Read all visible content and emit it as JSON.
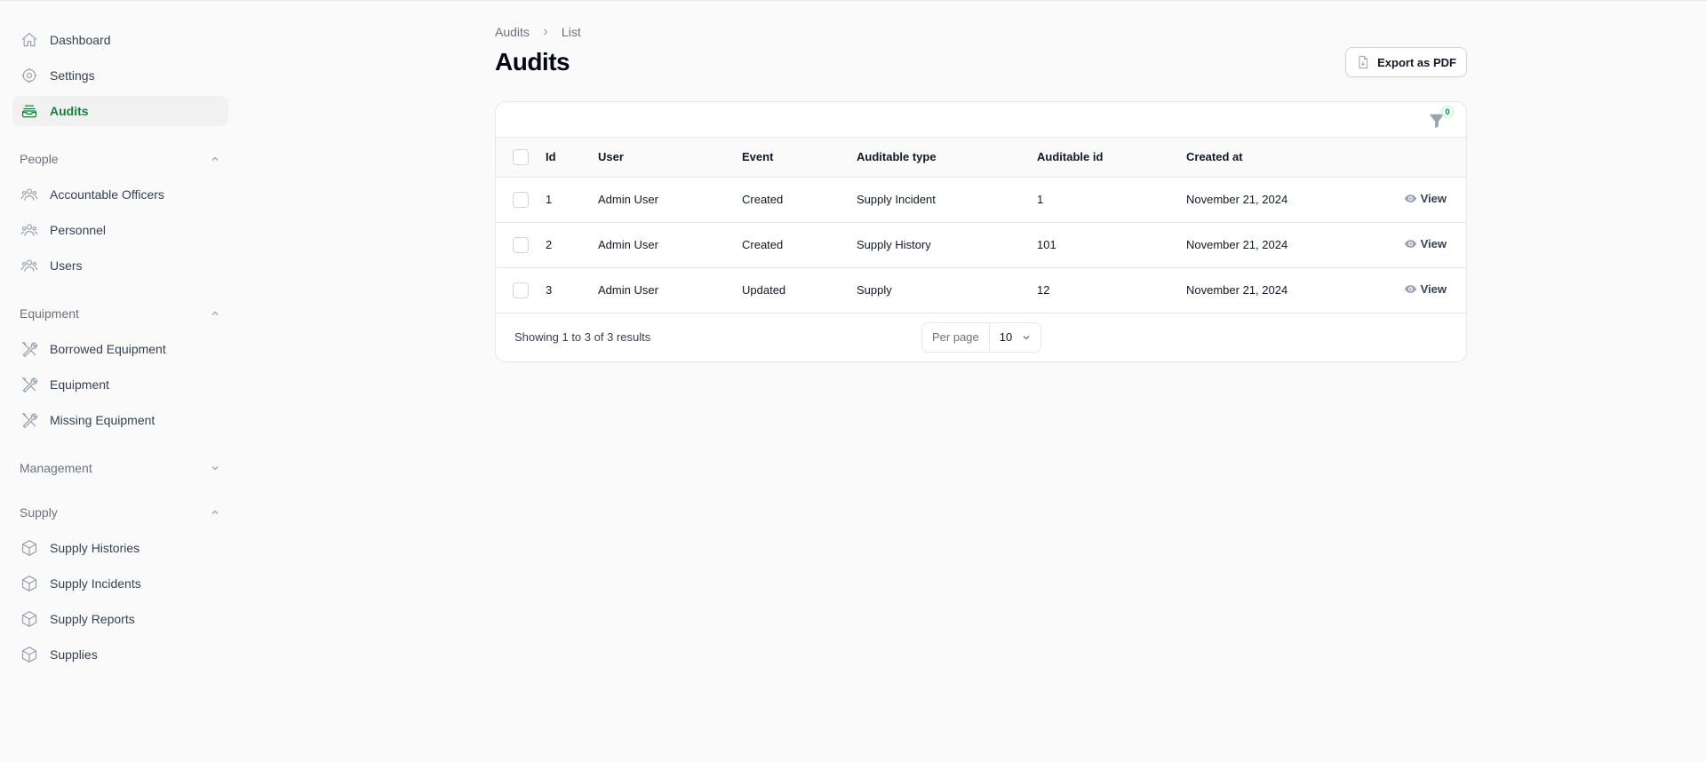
{
  "sidebar": {
    "top_items": [
      {
        "label": "Dashboard",
        "icon": "home-icon"
      },
      {
        "label": "Settings",
        "icon": "cog-icon"
      },
      {
        "label": "Audits",
        "icon": "inbox-stack-icon",
        "active": true
      }
    ],
    "groups": [
      {
        "label": "People",
        "expanded": true,
        "items": [
          {
            "label": "Accountable Officers",
            "icon": "user-group-icon"
          },
          {
            "label": "Personnel",
            "icon": "user-group-icon"
          },
          {
            "label": "Users",
            "icon": "user-group-icon"
          }
        ]
      },
      {
        "label": "Equipment",
        "expanded": true,
        "items": [
          {
            "label": "Borrowed Equipment",
            "icon": "wrench-screwdriver-icon"
          },
          {
            "label": "Equipment",
            "icon": "wrench-screwdriver-icon"
          },
          {
            "label": "Missing Equipment",
            "icon": "wrench-screwdriver-icon"
          }
        ]
      },
      {
        "label": "Management",
        "expanded": false,
        "items": []
      },
      {
        "label": "Supply",
        "expanded": true,
        "items": [
          {
            "label": "Supply Histories",
            "icon": "cube-icon"
          },
          {
            "label": "Supply Incidents",
            "icon": "cube-icon"
          },
          {
            "label": "Supply Reports",
            "icon": "cube-icon"
          },
          {
            "label": "Supplies",
            "icon": "cube-icon"
          }
        ]
      }
    ]
  },
  "breadcrumb": {
    "items": [
      "Audits",
      "List"
    ]
  },
  "page": {
    "title": "Audits",
    "export_label": "Export as PDF"
  },
  "filter": {
    "count": "0"
  },
  "table": {
    "columns": [
      "Id",
      "User",
      "Event",
      "Auditable type",
      "Auditable id",
      "Created at"
    ],
    "rows": [
      {
        "id": "1",
        "user": "Admin User",
        "event": "Created",
        "auditable_type": "Supply Incident",
        "auditable_id": "1",
        "created_at": "November 21, 2024",
        "action": "View"
      },
      {
        "id": "2",
        "user": "Admin User",
        "event": "Created",
        "auditable_type": "Supply History",
        "auditable_id": "101",
        "created_at": "November 21, 2024",
        "action": "View"
      },
      {
        "id": "3",
        "user": "Admin User",
        "event": "Updated",
        "auditable_type": "Supply",
        "auditable_id": "12",
        "created_at": "November 21, 2024",
        "action": "View"
      }
    ]
  },
  "pagination": {
    "results_text": "Showing 1 to 3 of 3 results",
    "per_page_label": "Per page",
    "per_page_value": "10"
  },
  "colors": {
    "accent": "#15803d",
    "background": "#fafafa",
    "border": "#e5e7eb"
  }
}
